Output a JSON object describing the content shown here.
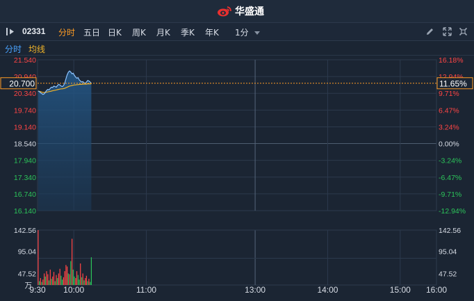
{
  "app": {
    "brand": "华盛通"
  },
  "toolbar": {
    "code": "02331",
    "tabs": [
      {
        "label": "分时",
        "active": true
      },
      {
        "label": "五日",
        "active": false
      },
      {
        "label": "日K",
        "active": false
      },
      {
        "label": "周K",
        "active": false
      },
      {
        "label": "月K",
        "active": false
      },
      {
        "label": "季K",
        "active": false
      },
      {
        "label": "年K",
        "active": false
      }
    ],
    "period": "1分",
    "icons": [
      "panel-collapse-icon",
      "pencil-icon",
      "expand-icon",
      "settings-icon"
    ]
  },
  "subbar": {
    "time_label": "分时",
    "avg_label": "均线"
  },
  "colors": {
    "up": "#ff4545",
    "down": "#2cc45a",
    "flat": "#d8dde6",
    "price_line": "#8ec4ff",
    "avg_line": "#f0b429",
    "accent": "#ff9c24",
    "area_fill": "#1e4a73",
    "grid": "#2c3a4d",
    "ref": "#4e5d70"
  },
  "current": {
    "price": "20.700",
    "pct": "11.65%"
  },
  "chart_data": {
    "type": "line",
    "y_price_labels": [
      "21.540",
      "20.940",
      "20.340",
      "19.740",
      "19.140",
      "18.540",
      "17.940",
      "17.340",
      "16.740",
      "16.140"
    ],
    "y_pct_labels": [
      "16.18%",
      "12.94%",
      "9.71%",
      "6.47%",
      "3.24%",
      "0.00%",
      "-3.24%",
      "-6.47%",
      "-9.71%",
      "-12.94%"
    ],
    "ref_price": 18.54,
    "ylim": [
      16.14,
      21.54
    ],
    "vol_labels": [
      "142.56",
      "95.04",
      "47.52"
    ],
    "vol_unit": "万",
    "vol_max": 142.56,
    "x_ticks": [
      "9:30",
      "10:00",
      "11:00",
      "13:00",
      "14:00",
      "15:00",
      "16:00"
    ],
    "total_minutes": 330,
    "price": [
      20.42,
      20.4,
      20.36,
      20.33,
      20.3,
      20.32,
      20.38,
      20.44,
      20.48,
      20.46,
      20.52,
      20.56,
      20.55,
      20.6,
      20.58,
      20.56,
      20.62,
      20.66,
      20.64,
      20.6,
      20.58,
      20.62,
      20.7,
      20.86,
      21.0,
      21.1,
      21.14,
      21.1,
      21.04,
      21.06,
      20.98,
      20.92,
      20.88,
      20.9,
      20.82,
      20.78,
      20.74,
      20.76,
      20.72,
      20.7,
      20.74,
      20.8,
      20.78,
      20.74,
      20.7
    ],
    "avg": [
      20.42,
      20.41,
      20.4,
      20.38,
      20.37,
      20.37,
      20.37,
      20.38,
      20.39,
      20.4,
      20.41,
      20.42,
      20.43,
      20.44,
      20.45,
      20.46,
      20.47,
      20.48,
      20.49,
      20.5,
      20.5,
      20.51,
      20.52,
      20.54,
      20.56,
      20.58,
      20.6,
      20.61,
      20.62,
      20.63,
      20.64,
      20.64,
      20.65,
      20.65,
      20.66,
      20.66,
      20.66,
      20.67,
      20.67,
      20.67,
      20.67,
      20.68,
      20.68,
      20.68,
      20.68
    ],
    "volume": [
      142.56,
      10,
      18,
      8,
      14,
      30,
      22,
      36,
      28,
      12,
      40,
      16,
      22,
      34,
      10,
      26,
      18,
      30,
      42,
      24,
      14,
      20,
      36,
      52,
      48,
      30,
      28,
      62,
      120,
      40,
      22,
      18,
      36,
      26,
      14,
      56,
      20,
      30,
      12,
      18,
      24,
      10,
      16,
      8,
      72
    ],
    "vol_dir": [
      "up",
      "down",
      "up",
      "down",
      "up",
      "up",
      "down",
      "up",
      "up",
      "down",
      "up",
      "down",
      "up",
      "up",
      "down",
      "up",
      "down",
      "up",
      "up",
      "down",
      "down",
      "up",
      "up",
      "up",
      "up",
      "down",
      "up",
      "down",
      "up",
      "down",
      "down",
      "up",
      "up",
      "down",
      "down",
      "up",
      "down",
      "up",
      "down",
      "up",
      "up",
      "down",
      "up",
      "down",
      "down"
    ]
  }
}
